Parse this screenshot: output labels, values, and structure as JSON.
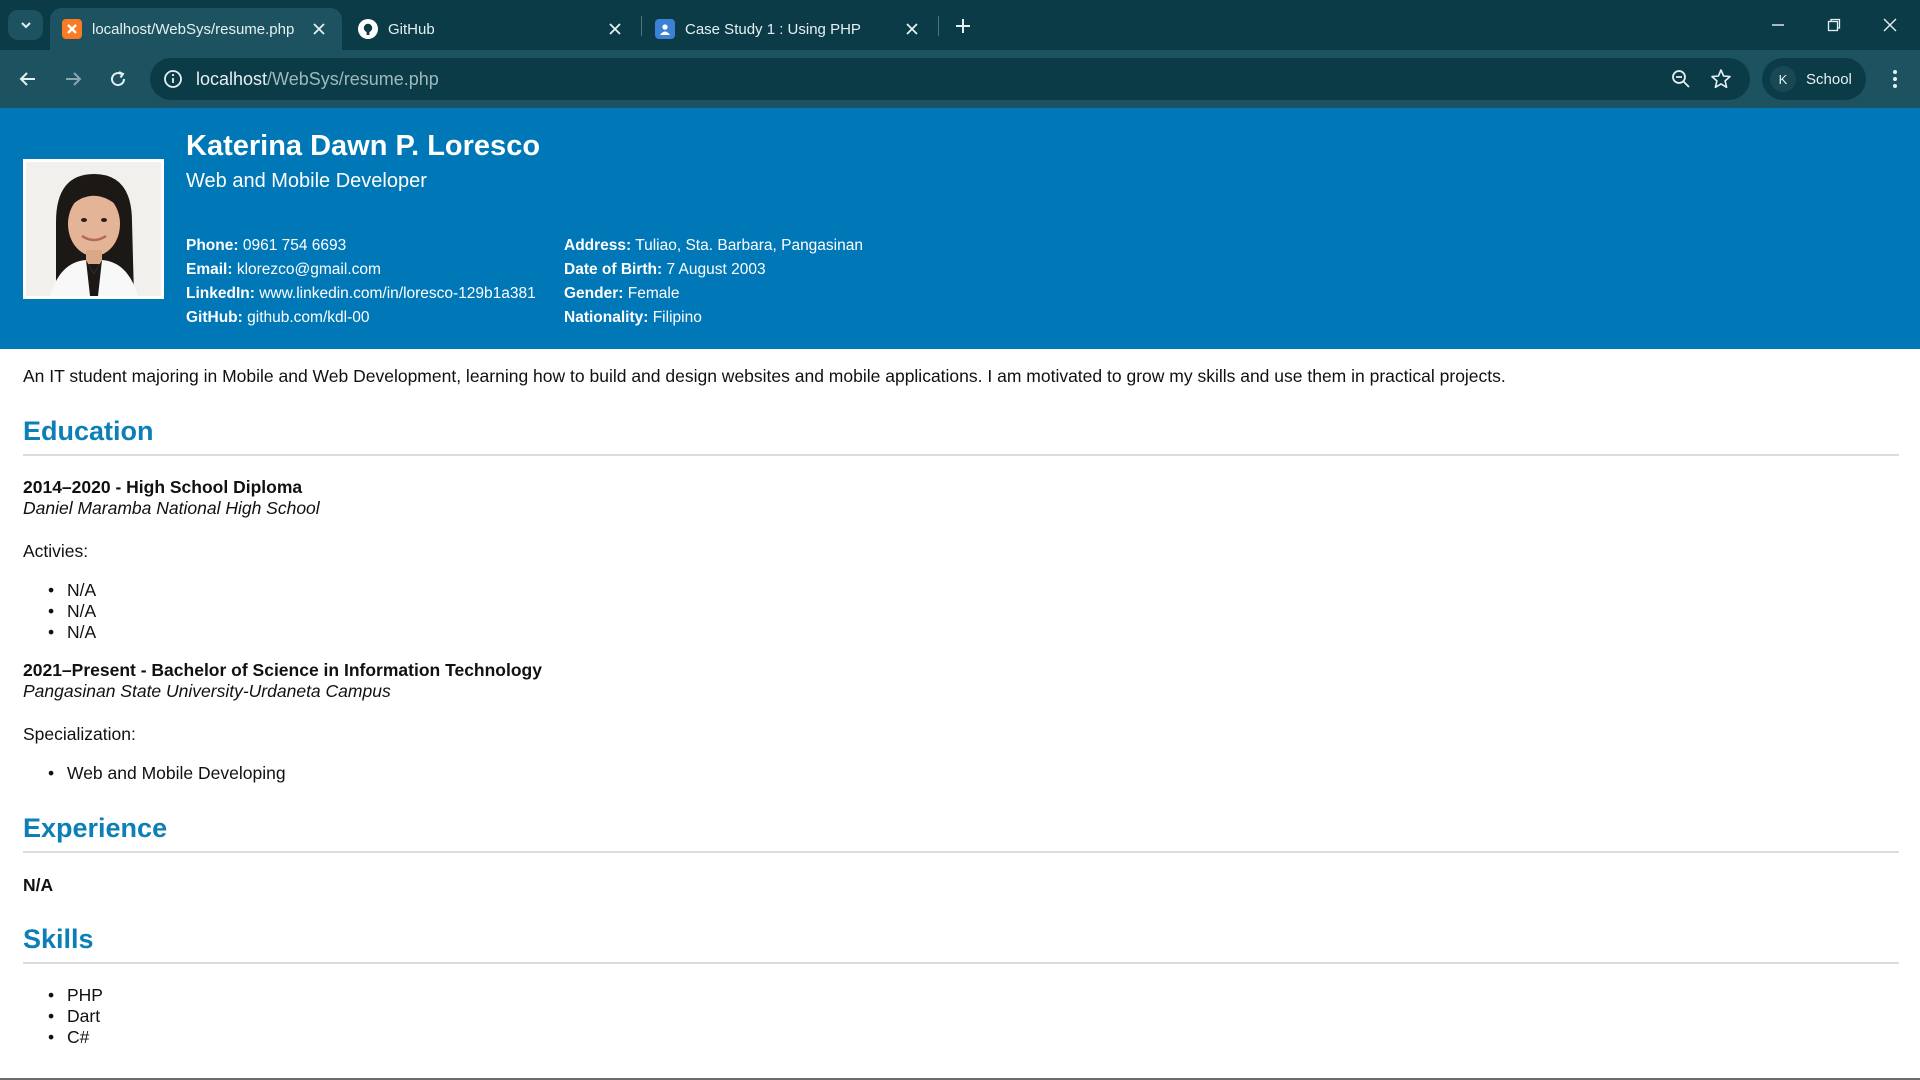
{
  "browser": {
    "tabs": [
      {
        "title": "localhost/WebSys/resume.php",
        "active": true,
        "favicon": "xampp-icon"
      },
      {
        "title": "GitHub",
        "active": false,
        "favicon": "github-icon"
      },
      {
        "title": "Case Study 1 : Using PHP",
        "active": false,
        "favicon": "classroom-icon"
      }
    ],
    "url_host": "localhost",
    "url_path": "/WebSys/resume.php",
    "profile_initial": "K",
    "profile_name": "School",
    "colors": {
      "frame": "#0b3b47",
      "toolbar": "#1d5361"
    }
  },
  "resume": {
    "name": "Katerina Dawn P. Loresco",
    "title": "Web and Mobile Developer",
    "header_color": "#0077b6",
    "contact_left": [
      {
        "label": "Phone:",
        "value": "0961 754 6693"
      },
      {
        "label": "Email:",
        "value": "klorezco@gmail.com"
      },
      {
        "label": "LinkedIn:",
        "value": "www.linkedin.com/in/loresco-129b1a381"
      },
      {
        "label": "GitHub:",
        "value": "github.com/kdl-00"
      }
    ],
    "contact_right": [
      {
        "label": "Address:",
        "value": "Tuliao, Sta. Barbara, Pangasinan"
      },
      {
        "label": "Date of Birth:",
        "value": "7 August 2003"
      },
      {
        "label": "Gender:",
        "value": "Female"
      },
      {
        "label": "Nationality:",
        "value": "Filipino"
      }
    ],
    "summary": "An IT student majoring in Mobile and Web Development, learning how to build and design websites and mobile applications. I am motivated to grow my skills and use them in practical projects.",
    "education_heading": "Education",
    "education": [
      {
        "title": "2014–2020 - High School Diploma",
        "school": "Daniel Maramba National High School",
        "list_label": "Activies:",
        "items": [
          "N/A",
          "N/A",
          "N/A"
        ]
      },
      {
        "title": "2021–Present - Bachelor of Science in Information Technology",
        "school": "Pangasinan State University-Urdaneta Campus",
        "list_label": "Specialization:",
        "items": [
          "Web and Mobile Developing"
        ]
      }
    ],
    "experience_heading": "Experience",
    "experience_text": "N/A",
    "skills_heading": "Skills",
    "skills": [
      "PHP",
      "Dart",
      "C#"
    ]
  }
}
